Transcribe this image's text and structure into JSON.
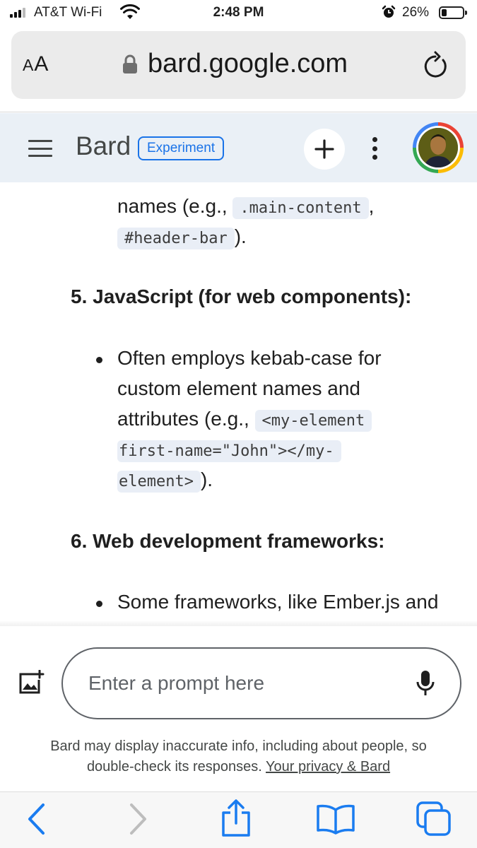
{
  "status_bar": {
    "carrier": "AT&T Wi-Fi",
    "time": "2:48 PM",
    "battery_percent": "26%",
    "battery_level": 0.26
  },
  "browser": {
    "text_size_small": "A",
    "text_size_large": "A",
    "domain": "bard.google.com"
  },
  "header": {
    "title": "Bard",
    "badge": "Experiment"
  },
  "content": {
    "line1_text": "names (e.g., ",
    "line1_code": ".main-content",
    "line1_after": ",",
    "line2_code": "#header-bar",
    "line2_after": ").",
    "section5_heading": "5. JavaScript (for web components):",
    "s5_line1": "Often employs kebab-case for",
    "s5_line2": "custom element names and",
    "s5_line3_text": "attributes (e.g., ",
    "s5_line3_code": "<my-element",
    "s5_line4_code": "first-name=\"John\"></my-",
    "s5_line5_code": "element>",
    "s5_line5_after": ").",
    "section6_heading": "6. Web development frameworks:",
    "s6_line1": "Some frameworks, like Ember.js and"
  },
  "prompt": {
    "placeholder": "Enter a prompt here"
  },
  "disclaimer": {
    "line1": "Bard may display inaccurate info, including about people, so",
    "line2": "double-check its responses. ",
    "privacy_link": "Your privacy & Bard"
  },
  "colors": {
    "accent": "#1a73e8",
    "header_bg": "#eaf0f6",
    "code_bg": "#e9eef6",
    "ios_blue": "#1a7cf0"
  },
  "icons": {
    "toolbar": [
      "back-icon",
      "forward-icon",
      "share-icon",
      "bookmarks-icon",
      "tabs-icon"
    ]
  }
}
